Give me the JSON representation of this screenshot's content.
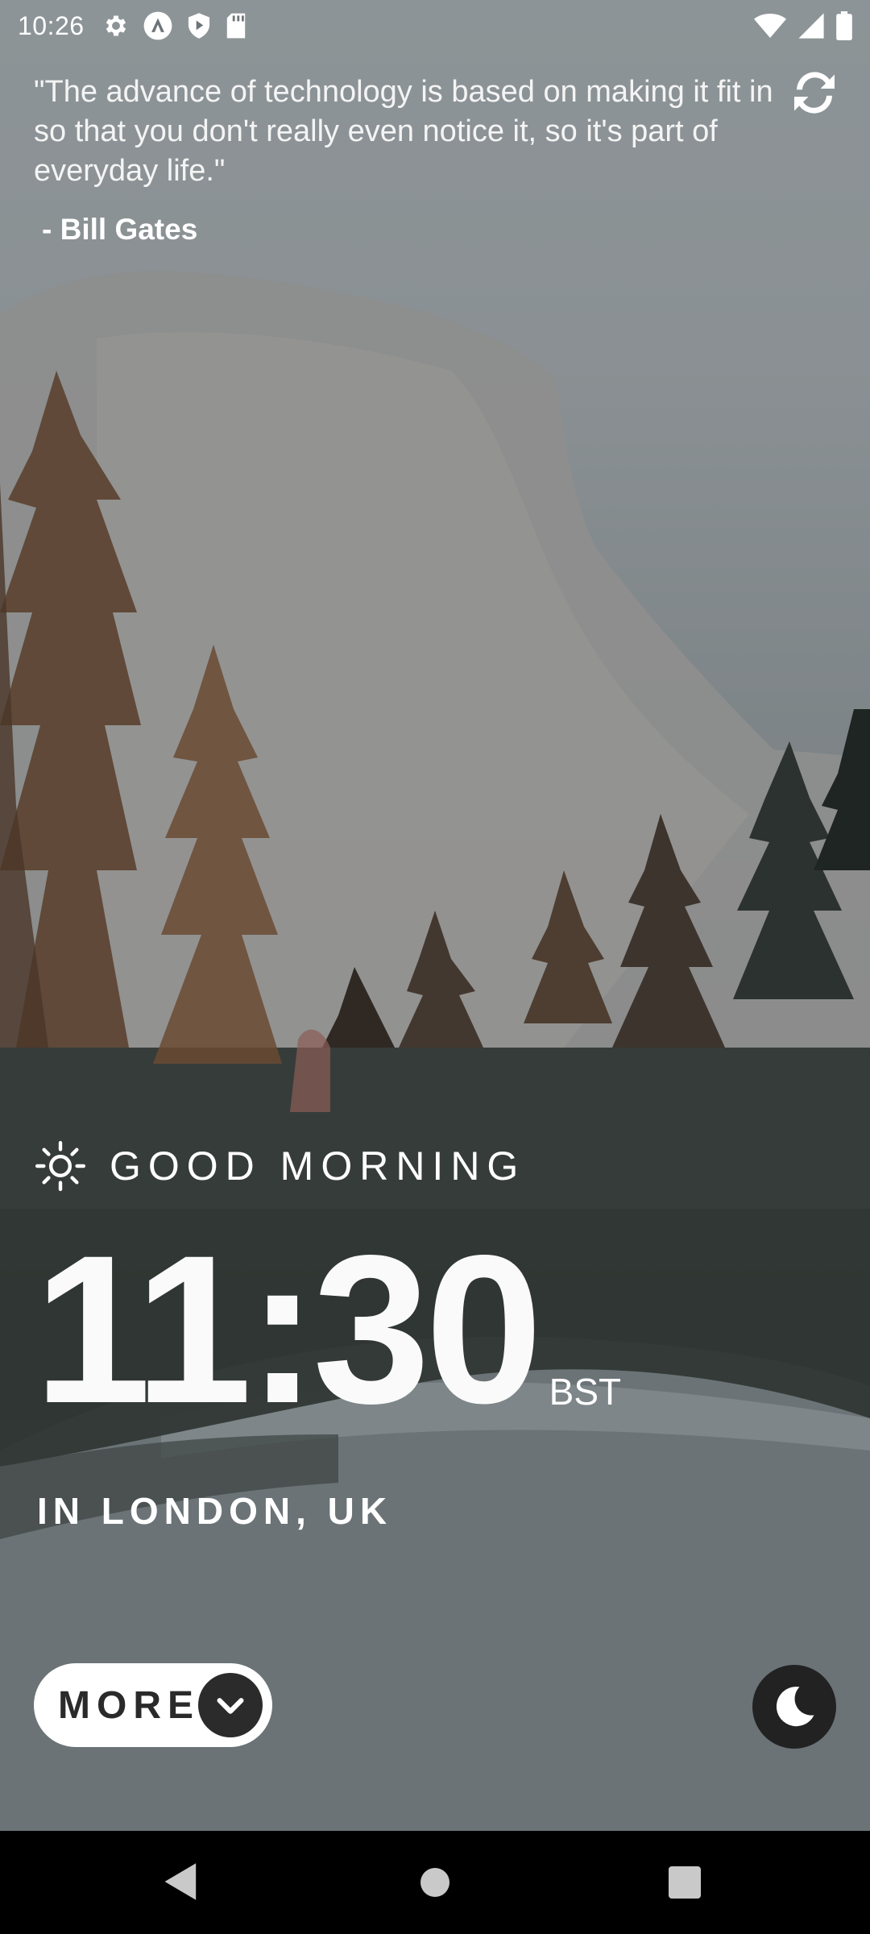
{
  "status_bar": {
    "time": "10:26",
    "icons": [
      "settings-icon",
      "autofill-icon",
      "shield-play-icon",
      "sd-card-icon"
    ],
    "right_icons": [
      "wifi-icon",
      "signal-icon",
      "battery-icon"
    ]
  },
  "quote": {
    "text": "\"The advance of technology is based on making it fit in so that you don't really even notice it, so it's part of everyday life.\"",
    "author": "- Bill Gates"
  },
  "greeting": {
    "icon": "sun-icon",
    "text": "GOOD MORNING"
  },
  "clock": {
    "time": "11:30",
    "zone": "BST",
    "location": "IN LONDON, UK"
  },
  "controls": {
    "more_label": "MORE",
    "more_icon": "chevron-down-icon",
    "theme_icon": "moon-icon"
  },
  "nav": {
    "back": "back-icon",
    "home": "home-icon",
    "recents": "recents-icon"
  },
  "colors": {
    "text": "#ffffff",
    "button_bg": "#ffffff",
    "button_text": "#2a2a2a",
    "dark_circle": "#222222"
  }
}
